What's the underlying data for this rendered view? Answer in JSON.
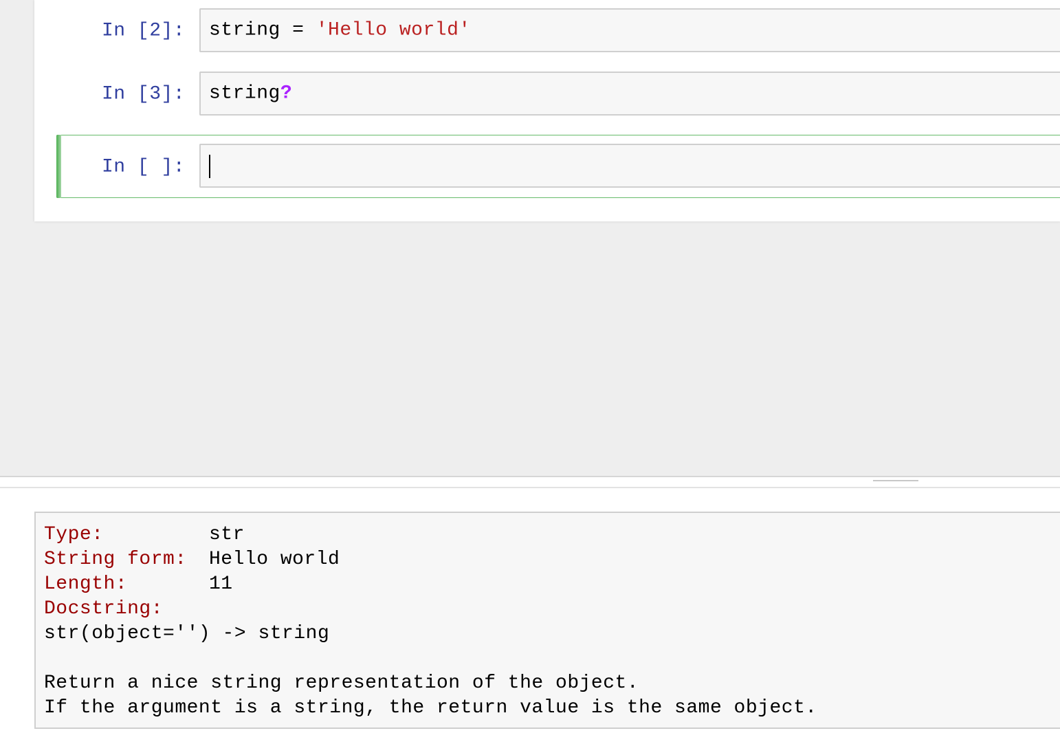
{
  "cells": [
    {
      "prompt": "In [2]:",
      "code_parts": [
        {
          "text": "string = ",
          "kind": "plain"
        },
        {
          "text": "'Hello world'",
          "kind": "string"
        }
      ]
    },
    {
      "prompt": "In [3]:",
      "code_parts": [
        {
          "text": "string",
          "kind": "plain"
        },
        {
          "text": "?",
          "kind": "operator"
        }
      ]
    },
    {
      "prompt": "In [ ]:",
      "code_parts": []
    }
  ],
  "pager": {
    "type_key": "Type:",
    "type_value": "str",
    "string_form_key": "String form:",
    "string_form_value": "Hello world",
    "length_key": "Length:",
    "length_value": "11",
    "docstring_key": "Docstring:",
    "doc_lines": [
      "str(object='') -> string",
      "",
      "Return a nice string representation of the object.",
      "If the argument is a string, the return value is the same object."
    ]
  },
  "colors": {
    "prompt": "#303f9f",
    "string_literal": "#ba2121",
    "operator": "#aa22ff",
    "pager_key": "#990000",
    "selected_cell_border": "#66bb6a"
  }
}
